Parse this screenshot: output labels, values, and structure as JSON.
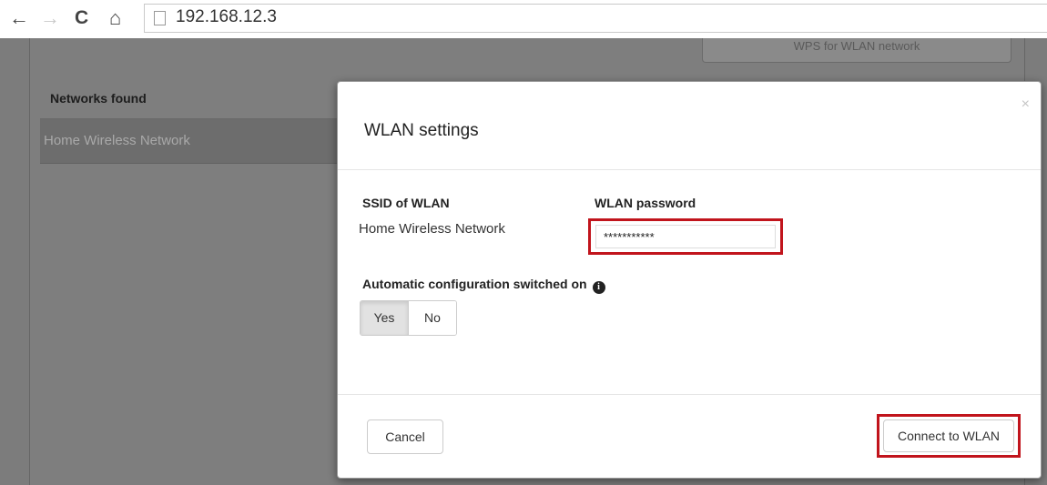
{
  "browser": {
    "url": "192.168.12.3",
    "back_glyph": "←",
    "forward_glyph": "→",
    "reload_glyph": "C",
    "home_glyph": "⌂"
  },
  "page": {
    "wps_button_label": "WPS for WLAN network",
    "networks_title": "Networks found",
    "networks": [
      {
        "name": "Home Wireless Network"
      }
    ]
  },
  "modal": {
    "title": "WLAN settings",
    "close_glyph": "×",
    "ssid_label": "SSID of WLAN",
    "ssid_value": "Home Wireless Network",
    "password_label": "WLAN password",
    "password_value": "***********",
    "auto_config_label": "Automatic configuration switched on",
    "info_glyph": "i",
    "toggle": {
      "yes": "Yes",
      "no": "No",
      "selected": "Yes"
    },
    "cancel_label": "Cancel",
    "connect_label": "Connect to WLAN"
  },
  "colors": {
    "highlight": "#c1141c",
    "overlay": "#7c7c7c"
  }
}
